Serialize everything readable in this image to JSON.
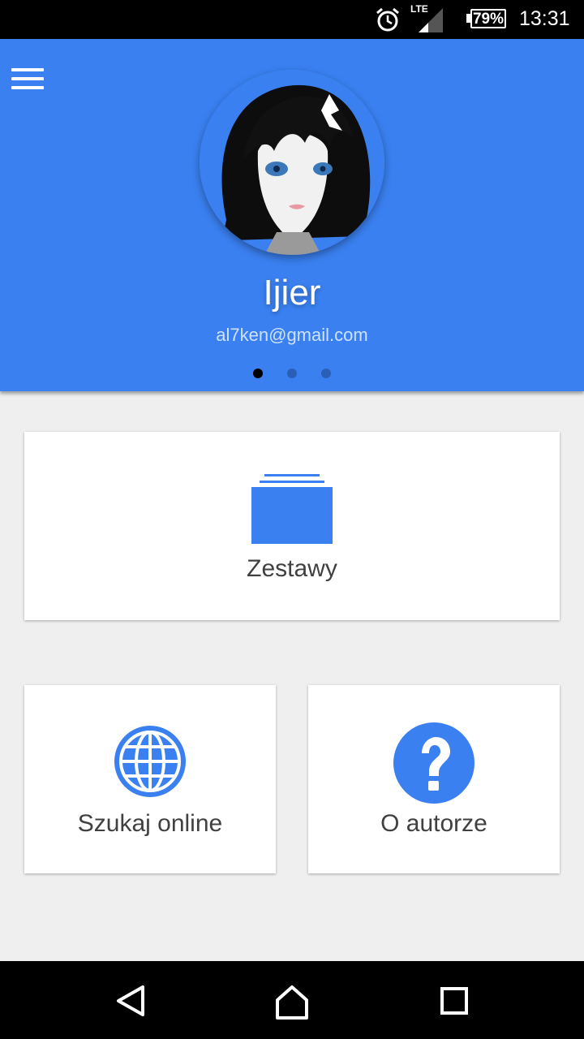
{
  "status_bar": {
    "network": "LTE",
    "battery": "79%",
    "time": "13:31",
    "icons": [
      "alarm-icon",
      "signal-icon",
      "battery-icon"
    ]
  },
  "header": {
    "menu_icon": "hamburger-menu-icon",
    "user_name": "Ijier",
    "user_email": "al7ken@gmail.com",
    "pager": {
      "count": 3,
      "active_index": 0
    },
    "background_color": "#3a80f0"
  },
  "tiles": {
    "sets": {
      "label": "Zestawy",
      "icon": "folder-stack-icon"
    },
    "search_online": {
      "label": "Szukaj online",
      "icon": "globe-icon"
    },
    "about_author": {
      "label": "O autorze",
      "icon": "help-circle-icon"
    }
  },
  "accent_color": "#3a80f0",
  "navigation": {
    "icons": [
      "back-icon",
      "home-icon",
      "recents-icon"
    ]
  }
}
